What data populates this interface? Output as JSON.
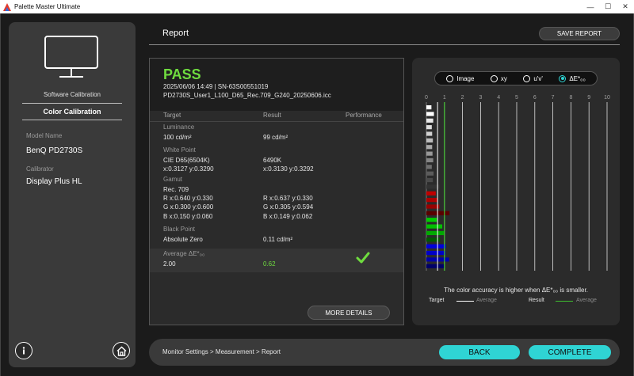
{
  "window": {
    "title": "Palette Master Ultimate",
    "min": "—",
    "max": "☐",
    "close": "✕"
  },
  "sidebar": {
    "software_calibration": "Software Calibration",
    "color_calibration": "Color Calibration",
    "model_name_label": "Model Name",
    "model_name_value": "BenQ PD2730S",
    "calibrator_label": "Calibrator",
    "calibrator_value": "Display Plus HL",
    "info_icon": "info-icon",
    "home_icon": "home-icon"
  },
  "header": {
    "title": "Report",
    "save_label": "SAVE REPORT"
  },
  "report": {
    "status": "PASS",
    "line1": "2025/06/06 14:49 | SN-63S00551019",
    "line2": "PD2730S_User1_L100_D65_Rec.709_G240_20250606.icc",
    "columns": [
      "Target",
      "Result",
      "Performance"
    ],
    "luminance": {
      "label": "Luminance",
      "target": "100 cd/m²",
      "result": "99 cd/m²"
    },
    "white_point": {
      "label": "White Point",
      "target1": "CIE D65(6504K)",
      "target2": "x:0.3127 y:0.3290",
      "result1": "6490K",
      "result2": "x:0.3130 y:0.3292"
    },
    "gamut": {
      "label": "Gamut",
      "target": [
        "Rec. 709",
        "R x:0.640 y:0.330",
        "G x:0.300 y:0.600",
        "B x:0.150 y:0.060"
      ],
      "result": [
        "R x:0.637 y:0.330",
        "G x:0.305 y:0.594",
        "B x:0.149 y:0.062"
      ]
    },
    "black_point": {
      "label": "Black Point",
      "target": "Absolute Zero",
      "result": "0.11 cd/m²"
    },
    "average": {
      "label": "Average ΔE*₀₀",
      "target": "2.00",
      "result": "0.62"
    },
    "more_details": "MORE DETAILS"
  },
  "view_options": [
    {
      "label": "Image",
      "selected": false
    },
    {
      "label": "xy",
      "selected": false
    },
    {
      "label": "u'v'",
      "selected": false
    },
    {
      "label": "ΔE*₀₀",
      "selected": true
    }
  ],
  "chart_data": {
    "type": "bar",
    "orientation": "horizontal",
    "x_ticks": [
      "0",
      "1",
      "2",
      "3",
      "4",
      "5",
      "6",
      "7",
      "8",
      "9",
      "10"
    ],
    "xlim": [
      0,
      10
    ],
    "target_average": 0.62,
    "result_average": 1.0,
    "bar_colors": [
      "#ffffff",
      "#ffffff",
      "#e8e8e8",
      "#dedede",
      "#d0d0d0",
      "#bdbdbd",
      "#ababab",
      "#999999",
      "#858585",
      "#707070",
      "#5c5c5c",
      "#4a4a4a",
      "#333333",
      "#c00000",
      "#b00000",
      "#9a0000",
      "#5a0000",
      "#00cc00",
      "#00c000",
      "#00aa00",
      "#005a00",
      "#0000dd",
      "#0000c8",
      "#0000a8",
      "#00006a"
    ],
    "values": [
      0.28,
      0.42,
      0.38,
      0.3,
      0.32,
      0.36,
      0.32,
      0.34,
      0.38,
      0.3,
      0.4,
      0.36,
      0.72,
      0.52,
      0.62,
      0.72,
      1.28,
      0.58,
      0.88,
      0.98,
      0.76,
      1.08,
      1.06,
      1.26,
      0.98
    ],
    "note": "The color accuracy is higher when ΔE*₀₀ is smaller.",
    "legend": {
      "target": "Target",
      "result": "Result",
      "average": "Average"
    },
    "colors": {
      "target_line": "#ffffff",
      "result_line": "#3fbf2f",
      "grid": "#ffffff",
      "axis": "#888888"
    }
  },
  "footer": {
    "breadcrumb": "Monitor Settings >  Measurement >  Report",
    "back": "BACK",
    "complete": "COMPLETE"
  },
  "colors": {
    "accent": "#2fd4d4",
    "pass": "#6fdc3f"
  }
}
